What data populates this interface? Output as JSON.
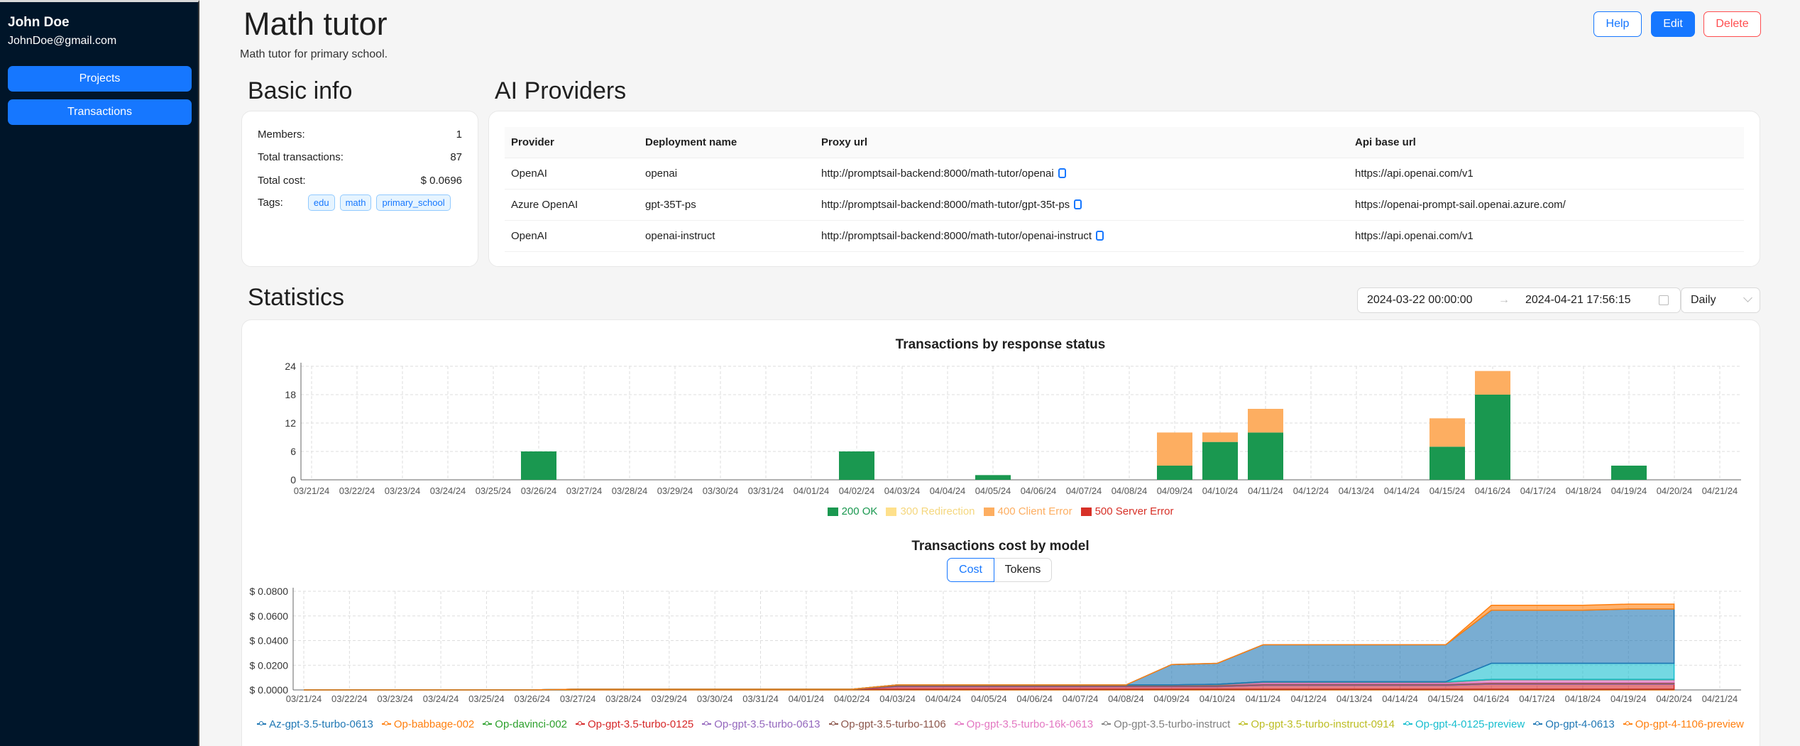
{
  "user": {
    "name": "John Doe",
    "email": "JohnDoe@gmail.com"
  },
  "nav": {
    "projects": "Projects",
    "transactions": "Transactions"
  },
  "header": {
    "title": "Math tutor",
    "description": "Math tutor for primary school.",
    "help": "Help",
    "edit": "Edit",
    "delete": "Delete"
  },
  "basic_info": {
    "title": "Basic info",
    "members_label": "Members:",
    "members": "1",
    "transactions_label": "Total transactions:",
    "transactions": "87",
    "cost_label": "Total cost:",
    "cost": "$ 0.0696",
    "tags_label": "Tags:",
    "tags": [
      "edu",
      "math",
      "primary_school"
    ]
  },
  "providers": {
    "title": "AI Providers",
    "columns": [
      "Provider",
      "Deployment name",
      "Proxy url",
      "Api base url"
    ],
    "rows": [
      {
        "provider": "OpenAI",
        "deployment": "openai",
        "proxy": "http://promptsail-backend:8000/math-tutor/openai",
        "api": "https://api.openai.com/v1"
      },
      {
        "provider": "Azure OpenAI",
        "deployment": "gpt-35T-ps",
        "proxy": "http://promptsail-backend:8000/math-tutor/gpt-35t-ps",
        "api": "https://openai-prompt-sail.openai.azure.com/"
      },
      {
        "provider": "OpenAI",
        "deployment": "openai-instruct",
        "proxy": "http://promptsail-backend:8000/math-tutor/openai-instruct",
        "api": "https://api.openai.com/v1"
      }
    ]
  },
  "statistics": {
    "title": "Statistics",
    "date_from": "2024-03-22 00:00:00",
    "date_to": "2024-04-21 17:56:15",
    "granularity": "Daily",
    "toggle_cost": "Cost",
    "toggle_tokens": "Tokens"
  },
  "colors": {
    "accent": "#1677ff",
    "sidebar": "#001529",
    "ok": "#1a9850",
    "redirect": "#fee08b",
    "client_error": "#fdae61",
    "server_error": "#d73027"
  },
  "chart_data": [
    {
      "type": "bar",
      "stacked": true,
      "title": "Transactions by response status",
      "categories": [
        "03/21/24",
        "03/22/24",
        "03/23/24",
        "03/24/24",
        "03/25/24",
        "03/26/24",
        "03/27/24",
        "03/28/24",
        "03/29/24",
        "03/30/24",
        "03/31/24",
        "04/01/24",
        "04/02/24",
        "04/03/24",
        "04/04/24",
        "04/05/24",
        "04/06/24",
        "04/07/24",
        "04/08/24",
        "04/09/24",
        "04/10/24",
        "04/11/24",
        "04/12/24",
        "04/13/24",
        "04/14/24",
        "04/15/24",
        "04/16/24",
        "04/17/24",
        "04/18/24",
        "04/19/24",
        "04/20/24",
        "04/21/24"
      ],
      "yticks": [
        "0",
        "6",
        "12",
        "18",
        "24"
      ],
      "ylim": [
        0,
        24
      ],
      "grid": true,
      "legend_position": "bottom",
      "series": [
        {
          "name": "200 OK",
          "color": "#1a9850",
          "values": [
            0,
            0,
            0,
            0,
            0,
            6,
            0,
            0,
            0,
            0,
            0,
            0,
            6,
            0,
            0,
            1,
            0,
            0,
            0,
            3,
            8,
            10,
            0,
            0,
            0,
            7,
            18,
            0,
            0,
            3,
            0,
            0
          ]
        },
        {
          "name": "300 Redirection",
          "color": "#fee08b",
          "values": [
            0,
            0,
            0,
            0,
            0,
            0,
            0,
            0,
            0,
            0,
            0,
            0,
            0,
            0,
            0,
            0,
            0,
            0,
            0,
            0,
            0,
            0,
            0,
            0,
            0,
            0,
            0,
            0,
            0,
            0,
            0,
            0
          ]
        },
        {
          "name": "400 Client Error",
          "color": "#fdae61",
          "values": [
            0,
            0,
            0,
            0,
            0,
            0,
            0,
            0,
            0,
            0,
            0,
            0,
            0,
            0,
            0,
            0,
            0,
            0,
            0,
            7,
            2,
            5,
            0,
            0,
            0,
            6,
            5,
            0,
            0,
            0,
            0,
            0
          ]
        },
        {
          "name": "500 Server Error",
          "color": "#d73027",
          "values": [
            0,
            0,
            0,
            0,
            0,
            0,
            0,
            0,
            0,
            0,
            0,
            0,
            0,
            0,
            0,
            0,
            0,
            0,
            0,
            0,
            0,
            0,
            0,
            0,
            0,
            0,
            0,
            0,
            0,
            0,
            0,
            0
          ]
        }
      ]
    },
    {
      "type": "area",
      "stacked": true,
      "title": "Transactions cost by model",
      "categories": [
        "03/21/24",
        "03/22/24",
        "03/23/24",
        "03/24/24",
        "03/25/24",
        "03/26/24",
        "03/27/24",
        "03/28/24",
        "03/29/24",
        "03/30/24",
        "03/31/24",
        "04/01/24",
        "04/02/24",
        "04/03/24",
        "04/04/24",
        "04/05/24",
        "04/06/24",
        "04/07/24",
        "04/08/24",
        "04/09/24",
        "04/10/24",
        "04/11/24",
        "04/12/24",
        "04/13/24",
        "04/14/24",
        "04/15/24",
        "04/16/24",
        "04/17/24",
        "04/18/24",
        "04/19/24",
        "04/20/24",
        "04/21/24"
      ],
      "yticks": [
        "$ 0.0000",
        "$ 0.0200",
        "$ 0.0400",
        "$ 0.0600",
        "$ 0.0800"
      ],
      "ylim": [
        0,
        0.08
      ],
      "grid": true,
      "legend_position": "bottom",
      "series": [
        {
          "name": "Az-gpt-3.5-turbo-0613",
          "color": "#1f77b4",
          "values": [
            0,
            0,
            0,
            0,
            0,
            0,
            0,
            0,
            0,
            0,
            0,
            0,
            0,
            0,
            0,
            0,
            0,
            0,
            0,
            0,
            0,
            0,
            0,
            0,
            0,
            0,
            0,
            0,
            0,
            0,
            0,
            0
          ]
        },
        {
          "name": "Op-babbage-002",
          "color": "#ff7f0e",
          "values": [
            0,
            0,
            0,
            0,
            0,
            0,
            0.0004,
            0.0004,
            0.0004,
            0.0004,
            0.0004,
            0.0004,
            0.0004,
            0.0004,
            0.0004,
            0.0004,
            0.0004,
            0.0004,
            0.0004,
            0.0004,
            0.0004,
            0.0004,
            0.0004,
            0.0004,
            0.0004,
            0.0004,
            0.0004,
            0.0004,
            0.0004,
            0.0004,
            0.0004,
            0
          ]
        },
        {
          "name": "Op-davinci-002",
          "color": "#2ca02c",
          "values": [
            0,
            0,
            0,
            0,
            0,
            0,
            0.0002,
            0.0002,
            0.0002,
            0.0002,
            0.0002,
            0.0002,
            0.0002,
            0.0002,
            0.0002,
            0.0002,
            0.0002,
            0.0002,
            0.0002,
            0.0002,
            0.0002,
            0.0002,
            0.0002,
            0.0002,
            0.0002,
            0.0002,
            0.0002,
            0.0002,
            0.0002,
            0.0002,
            0.0002,
            0
          ]
        },
        {
          "name": "Op-gpt-3.5-turbo-0125",
          "color": "#d62728",
          "values": [
            0,
            0,
            0,
            0,
            0,
            0,
            0,
            0,
            0,
            0,
            0,
            0,
            0,
            0.002,
            0.002,
            0.002,
            0.002,
            0.002,
            0.002,
            0.002,
            0.002,
            0.003,
            0.003,
            0.003,
            0.003,
            0.003,
            0.004,
            0.004,
            0.004,
            0.004,
            0.004,
            0
          ]
        },
        {
          "name": "Op-gpt-3.5-turbo-0613",
          "color": "#9467bd",
          "values": [
            0,
            0,
            0,
            0,
            0,
            0,
            0,
            0,
            0,
            0,
            0,
            0,
            0,
            0.0005,
            0.0005,
            0.0005,
            0.0005,
            0.0005,
            0.0005,
            0.0005,
            0.0005,
            0.0005,
            0.0005,
            0.0005,
            0.0005,
            0.0005,
            0.0005,
            0.0005,
            0.0005,
            0.0005,
            0.0005,
            0
          ]
        },
        {
          "name": "Op-gpt-3.5-turbo-1106",
          "color": "#8c564b",
          "values": [
            0,
            0,
            0,
            0,
            0,
            0,
            0,
            0,
            0,
            0,
            0,
            0,
            0,
            0.001,
            0.001,
            0.001,
            0.001,
            0.001,
            0.001,
            0.001,
            0.001,
            0.001,
            0.001,
            0.001,
            0.001,
            0.001,
            0.001,
            0.001,
            0.001,
            0.001,
            0.001,
            0
          ]
        },
        {
          "name": "Op-gpt-3.5-turbo-16k-0613",
          "color": "#e377c2",
          "values": [
            0,
            0,
            0,
            0,
            0,
            0,
            0,
            0,
            0,
            0,
            0,
            0,
            0,
            0,
            0,
            0,
            0,
            0,
            0,
            0,
            0,
            0.001,
            0.001,
            0.001,
            0.001,
            0.001,
            0.002,
            0.002,
            0.002,
            0.002,
            0.002,
            0
          ]
        },
        {
          "name": "Op-gpt-3.5-turbo-instruct",
          "color": "#7f7f7f",
          "values": [
            0,
            0,
            0,
            0,
            0,
            0,
            0,
            0,
            0,
            0,
            0,
            0,
            0,
            0,
            0,
            0,
            0,
            0,
            0,
            0,
            0.0005,
            0.0005,
            0.0005,
            0.0005,
            0.0005,
            0.0005,
            0.0005,
            0.0005,
            0.0005,
            0.0005,
            0.0005,
            0
          ]
        },
        {
          "name": "Op-gpt-3.5-turbo-instruct-0914",
          "color": "#bcbd22",
          "values": [
            0,
            0,
            0,
            0,
            0,
            0,
            0,
            0,
            0,
            0,
            0,
            0,
            0,
            0,
            0,
            0,
            0,
            0,
            0,
            0,
            0,
            0,
            0,
            0,
            0,
            0,
            0,
            0,
            0,
            0,
            0,
            0
          ]
        },
        {
          "name": "Op-gpt-4-0125-preview",
          "color": "#17becf",
          "values": [
            0,
            0,
            0,
            0,
            0,
            0,
            0,
            0,
            0,
            0,
            0,
            0,
            0,
            0,
            0,
            0,
            0,
            0,
            0,
            0,
            0,
            0,
            0,
            0,
            0,
            0,
            0.013,
            0.013,
            0.013,
            0.013,
            0.013,
            0
          ]
        },
        {
          "name": "Op-gpt-4-0613",
          "color": "#1f77b4",
          "values": [
            0,
            0,
            0,
            0,
            0,
            0,
            0,
            0,
            0,
            0,
            0,
            0,
            0,
            0,
            0,
            0,
            0,
            0,
            0,
            0.0165,
            0.017,
            0.03,
            0.03,
            0.03,
            0.03,
            0.03,
            0.043,
            0.043,
            0.043,
            0.044,
            0.044,
            0
          ]
        },
        {
          "name": "Op-gpt-4-1106-preview",
          "color": "#ff7f0e",
          "values": [
            0,
            0,
            0,
            0,
            0,
            0,
            0,
            0,
            0,
            0,
            0,
            0,
            0,
            0,
            0,
            0,
            0,
            0,
            0,
            0,
            0,
            0,
            0,
            0,
            0,
            0,
            0.004,
            0.004,
            0.004,
            0.004,
            0.004,
            0
          ]
        }
      ]
    }
  ]
}
